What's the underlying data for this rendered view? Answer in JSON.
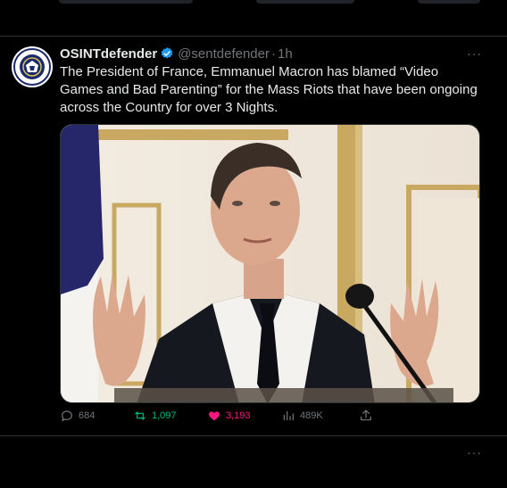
{
  "tweet": {
    "author_name": "OSINTdefender",
    "handle": "@sentdefender",
    "dot": "·",
    "time": "1h",
    "more": "···",
    "text": "The President of France, Emmanuel Macron has blamed “Video Games and Bad Parenting” for the Mass Riots that have been ongoing across the Country for over 3 Nights.",
    "actions": {
      "replies": "684",
      "retweets": "1,097",
      "likes": "3,193",
      "views": "489K"
    }
  },
  "next_tweet": {
    "more": "···"
  },
  "colors": {
    "background": "#000000",
    "text": "#e7e9ea",
    "muted": "#71767b",
    "verified": "#1d9bf0",
    "retweet_active": "#00ba7c",
    "like_active": "#f91880",
    "divider": "#2f3336"
  },
  "icons": [
    "verified-badge-icon",
    "reply-icon",
    "retweet-icon",
    "heart-icon",
    "views-icon",
    "share-icon"
  ]
}
